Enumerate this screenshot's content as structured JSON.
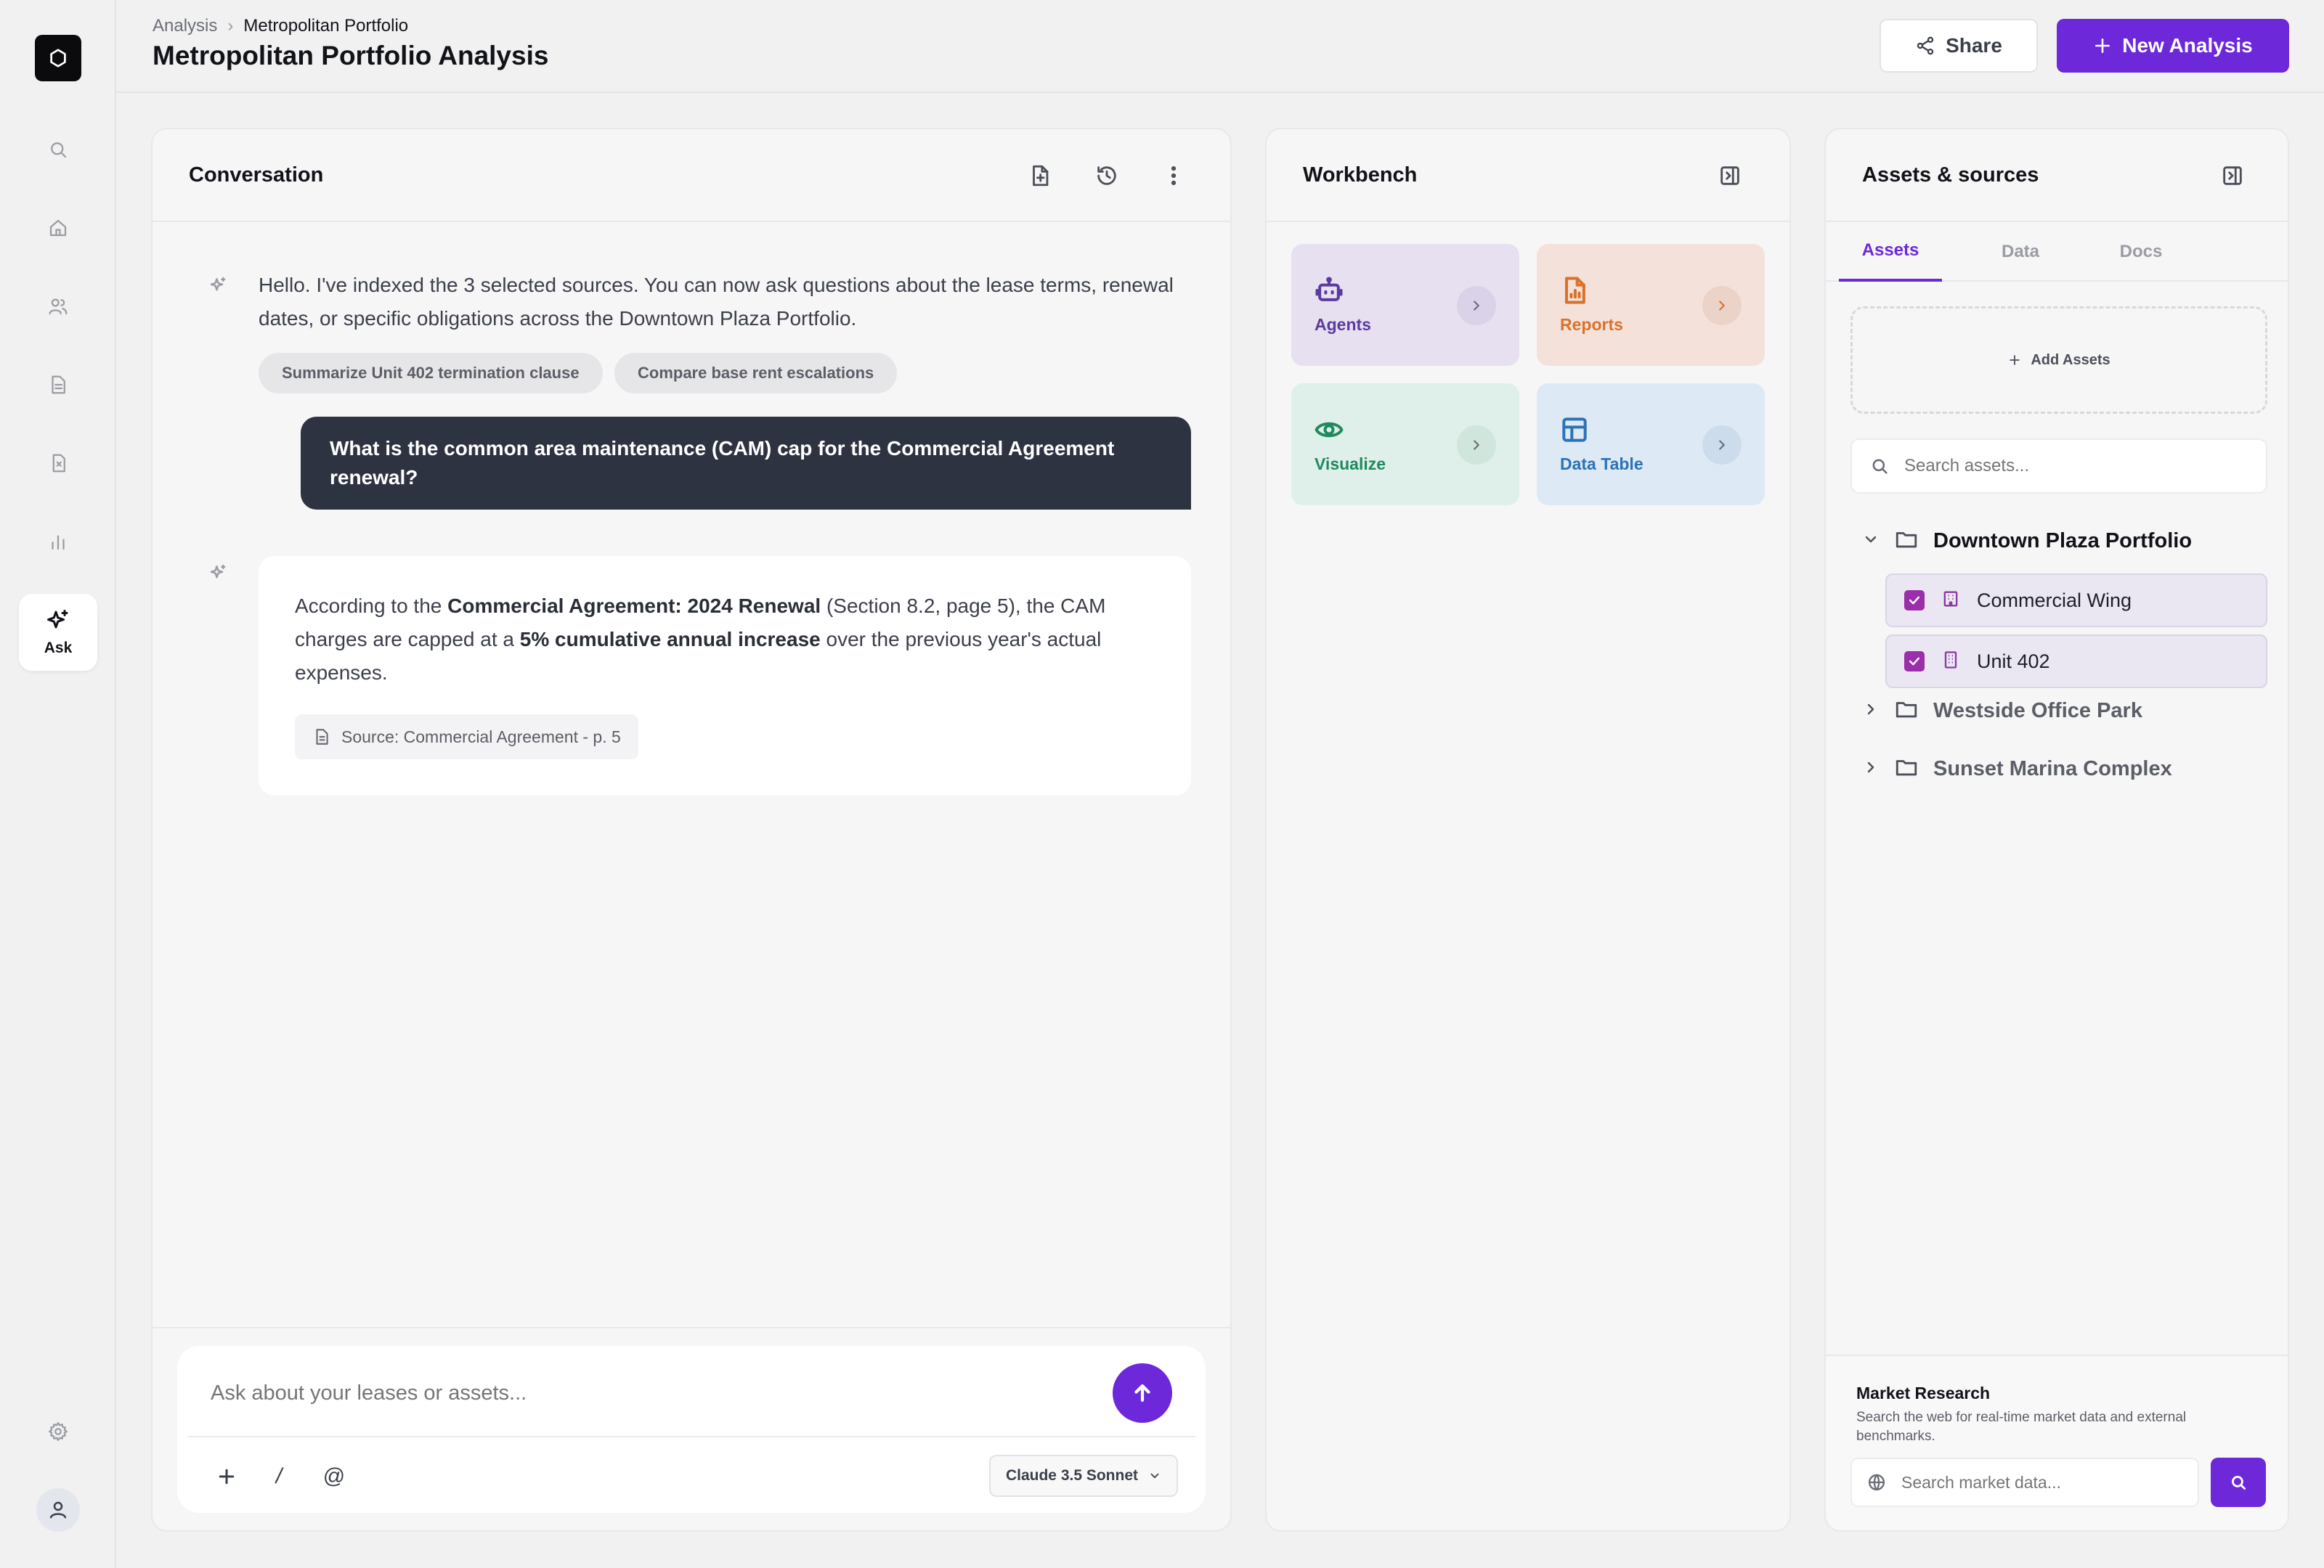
{
  "header": {
    "breadcrumb": [
      "Analysis",
      "Metropolitan Portfolio"
    ],
    "title": "Metropolitan Portfolio Analysis",
    "share_label": "Share",
    "new_label": "New Analysis"
  },
  "rail": {
    "ask_label": "Ask",
    "icons": [
      "search-icon",
      "home-icon",
      "users-icon",
      "document-icon",
      "files-icon",
      "chart-icon",
      "sparkles-icon",
      "settings-icon",
      "user-icon"
    ]
  },
  "conversation": {
    "title": "Conversation",
    "greeting": "Hello. I've indexed the 3 selected sources. You can now ask questions about the lease terms, renewal dates, or specific obligations across the Downtown Plaza Portfolio.",
    "suggestions": [
      "Summarize Unit 402 termination clause",
      "Compare base rent escalations"
    ],
    "user_message": "What is the common area maintenance (CAM) cap for the Commercial Agreement renewal?",
    "answer": {
      "p1": "According to the ",
      "b1": "Commercial Agreement: 2024 Renewal",
      "p2": " (Section 8.2, page 5), the CAM charges are capped at a ",
      "b2": "5% cumulative annual increase",
      "p3": " over the previous year's actual expenses."
    },
    "source": "Source: Commercial Agreement - p. 5",
    "composer": {
      "placeholder": "Ask about your leases or assets...",
      "slash": "/",
      "at": "@",
      "model": "Claude 3.5 Sonnet"
    }
  },
  "workbench": {
    "title": "Workbench",
    "tiles": [
      {
        "label": "Agents",
        "color": "#5b3a9e",
        "bg": "#e6e0f1"
      },
      {
        "label": "Reports",
        "color": "#d9722b",
        "bg": "#f4e2da"
      },
      {
        "label": "Visualize",
        "color": "#1f8a5f",
        "bg": "#dff0ea"
      },
      {
        "label": "Data Table",
        "color": "#2b73b8",
        "bg": "#dde9f5"
      }
    ]
  },
  "assets": {
    "title": "Assets & sources",
    "tabs": [
      "Assets",
      "Data",
      "Docs"
    ],
    "active_tab": "Assets",
    "add_label": "Add Assets",
    "search_placeholder": "Search assets...",
    "folders": [
      {
        "name": "Downtown Plaza Portfolio",
        "expanded": true,
        "items": [
          {
            "name": "Commercial Wing",
            "checked": true
          },
          {
            "name": "Unit 402",
            "checked": true
          }
        ]
      },
      {
        "name": "Westside Office Park",
        "expanded": false
      },
      {
        "name": "Sunset Marina Complex",
        "expanded": false
      }
    ],
    "market": {
      "title": "Market Research",
      "description": "Search the web for real-time market data and external benchmarks.",
      "placeholder": "Search market data..."
    }
  },
  "colors": {
    "accent": "#6d28d9",
    "user_bubble": "#2d3340",
    "checkbox": "#9b2eaa"
  }
}
